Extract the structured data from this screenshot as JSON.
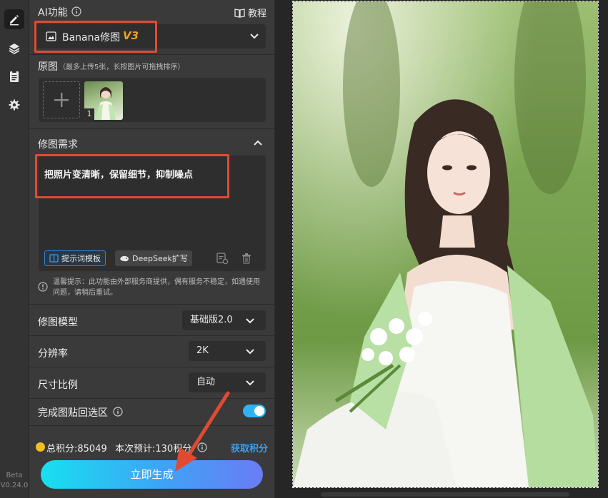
{
  "toolbar": {
    "tools": [
      {
        "icon": "edit-icon",
        "active": true
      },
      {
        "icon": "layers-icon",
        "active": false
      },
      {
        "icon": "clipboard-icon",
        "active": false
      },
      {
        "icon": "gear-icon",
        "active": false
      }
    ],
    "beta_label": "Beta",
    "version": "V0.24.0"
  },
  "ai": {
    "header": "AI功能",
    "tutorial_label": "教程",
    "function_name": "Banana修图",
    "function_version": "V3"
  },
  "original": {
    "label": "原图",
    "hint": "（最多上传5张，长按图片可拖拽排序）",
    "thumb_index": "1"
  },
  "request": {
    "label": "修图需求",
    "prompt_text": "把照片变清晰，保留细节，抑制噪点",
    "template_button": "提示词模板",
    "deepseek_button": "DeepSeek扩写",
    "notice": "温馨提示：此功能由外部服务商提供，偶有服务不稳定，如遇使用问题，请稍后重试。"
  },
  "settings": {
    "model_label": "修图模型",
    "model_value": "基础版2.0",
    "resolution_label": "分辨率",
    "resolution_value": "2K",
    "ratio_label": "尺寸比例",
    "ratio_value": "自动",
    "paste_back_label": "完成图贴回选区",
    "paste_back_on": true
  },
  "credits": {
    "total": "总积分:85049",
    "estimate": "本次预计:130积分",
    "get_link": "获取积分"
  },
  "generate_label": "立即生成",
  "colors": {
    "accent_cyan": "#2fb3f0",
    "annotation_red": "#e04a33",
    "version_orange": "#f0a020",
    "get_credits_blue": "#3aa0f0"
  }
}
